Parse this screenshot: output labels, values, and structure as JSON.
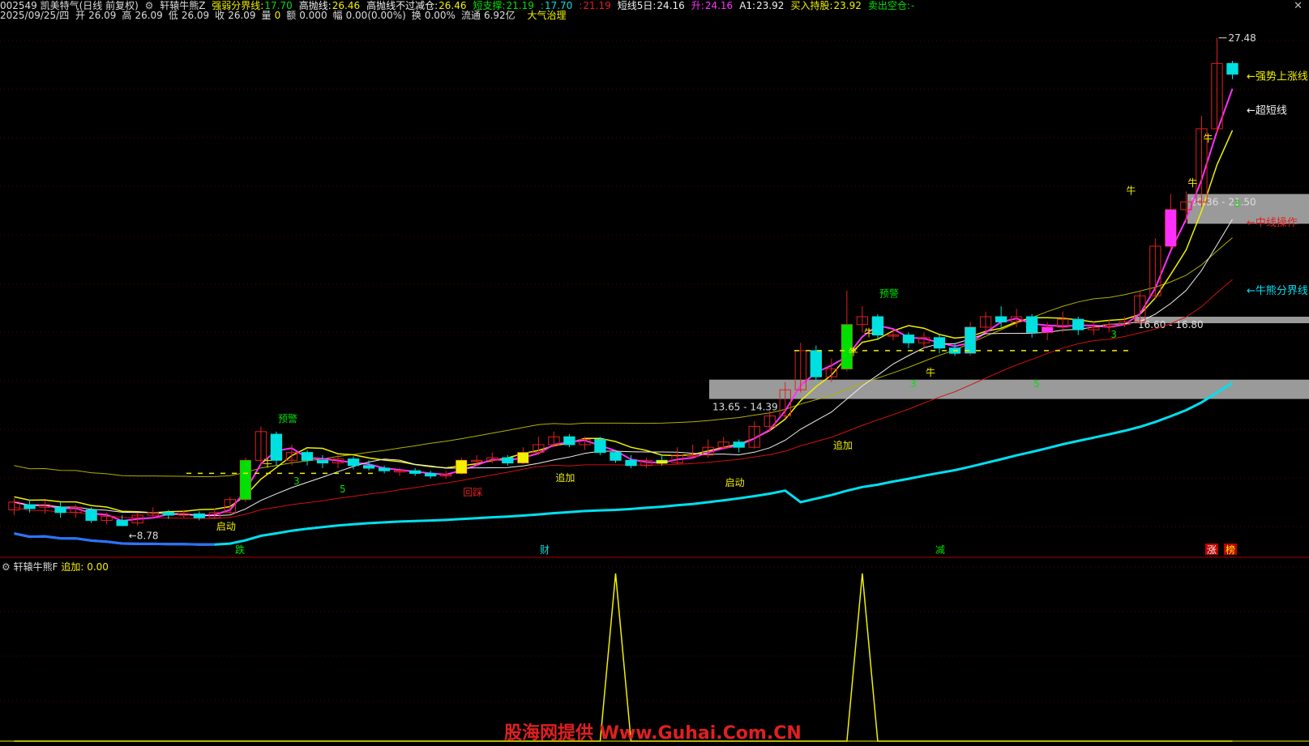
{
  "header1": {
    "stock": "002549 凯美特气(日线 前复权)",
    "indicator": "轩辕牛熊Z",
    "items": [
      {
        "label": "强弱分界线:",
        "value": "17.70",
        "lc": "#f0f000",
        "vc": "#00e000"
      },
      {
        "label": "高抛线:",
        "value": "26.46",
        "lc": "#f0f0f0",
        "vc": "#f0f000"
      },
      {
        "label": "高抛线不过减仓:",
        "value": "26.46",
        "lc": "#f0f0f0",
        "vc": "#f0f000"
      },
      {
        "label": "短支撑:",
        "value": "21.19",
        "lc": "#00e000",
        "vc": "#00e000"
      },
      {
        "label": ":",
        "value": "17.70",
        "lc": "#00e000",
        "vc": "#00e0e0"
      },
      {
        "label": ":",
        "value": "21.19",
        "lc": "#e02020",
        "vc": "#e02020"
      },
      {
        "label": "短线5日:",
        "value": "24.16",
        "lc": "#f0f0f0",
        "vc": "#f0f0f0"
      },
      {
        "label": "升:",
        "value": "24.16",
        "lc": "#ff30ff",
        "vc": "#ff30ff"
      },
      {
        "label": "A1:",
        "value": "23.92",
        "lc": "#f0f0f0",
        "vc": "#f0f0f0"
      },
      {
        "label": "买入持股:",
        "value": "23.92",
        "lc": "#f0f000",
        "vc": "#f0f000"
      },
      {
        "label": "卖出空仓:",
        "value": "-",
        "lc": "#00e000",
        "vc": "#00e000"
      }
    ]
  },
  "header2": {
    "date": "2025/09/25/四",
    "items": [
      {
        "label": "开",
        "value": "26.09"
      },
      {
        "label": "高",
        "value": "26.09"
      },
      {
        "label": "低",
        "value": "26.09"
      },
      {
        "label": "收",
        "value": "26.09"
      },
      {
        "label": "量",
        "value": "0"
      },
      {
        "label": "额",
        "value": "0.000"
      },
      {
        "label": "幅",
        "value": "0.00(0.00%)"
      },
      {
        "label": "换",
        "value": "0.00%"
      },
      {
        "label": "流通",
        "value": "6.92亿"
      }
    ],
    "extra": "大气治理"
  },
  "subchart": {
    "title": "轩辕牛熊F",
    "label": "追加:",
    "value": "0.00"
  },
  "watermark": "股海网提供 Www.Guhai.Com.CN",
  "close_icon": "close-icon",
  "colors": {
    "up": "#e02020",
    "down": "#00e0e0",
    "fast": "#ff30ff",
    "support": "#00e0f0"
  },
  "chart_data": [
    {
      "type": "candlestick",
      "title": "",
      "max_label": "27.48",
      "min_label": "8.78",
      "right_labels": [
        {
          "text": "强势上涨线",
          "color": "#f0f000"
        },
        {
          "text": "超短线",
          "color": "#f0f0f0"
        },
        {
          "text": "中线操作",
          "color": "#e02020"
        },
        {
          "text": "牛熊分界线",
          "color": "#00e0f0"
        }
      ],
      "zones": [
        {
          "label": "13.65 - 14.39",
          "low": 13.65,
          "high": 14.39
        },
        {
          "label": "16.60 - 16.80",
          "low": 16.6,
          "high": 16.8
        },
        {
          "label": "20.36 - 21.50",
          "low": 20.36,
          "high": 21.5
        }
      ],
      "signals": [
        {
          "text": "启动",
          "color": "#f0f000"
        },
        {
          "text": "预警",
          "color": "#00e000"
        },
        {
          "text": "回踩",
          "color": "#e02020"
        },
        {
          "text": "追加",
          "color": "#f0f000"
        },
        {
          "text": "启动",
          "color": "#f0f000"
        },
        {
          "text": "追加",
          "color": "#f0f000"
        },
        {
          "text": "预警",
          "color": "#00e000"
        },
        {
          "text": "牛",
          "color": "#f0f000"
        },
        {
          "text": "牛",
          "color": "#f0f000"
        },
        {
          "text": "牛",
          "color": "#f0f000"
        },
        {
          "text": "牛",
          "color": "#f0f000"
        },
        {
          "text": "牛",
          "color": "#f0f000"
        },
        {
          "text": "牛",
          "color": "#f0f000"
        },
        {
          "text": "牛",
          "color": "#f0f000"
        },
        {
          "text": "3",
          "color": "#00e000"
        },
        {
          "text": "5",
          "color": "#00e000"
        },
        {
          "text": "3",
          "color": "#00e000"
        },
        {
          "text": "3",
          "color": "#00e000"
        },
        {
          "text": "5",
          "color": "#00e000"
        },
        {
          "text": "3",
          "color": "#00e000"
        }
      ],
      "markers": [
        {
          "text": "跌",
          "color": "#00e000"
        },
        {
          "text": "财",
          "color": "#00e0e0"
        },
        {
          "text": "减",
          "color": "#00e000"
        },
        {
          "text": "涨",
          "color": "#f0f0f0"
        },
        {
          "text": "榜",
          "color": "#f0f000"
        }
      ],
      "support_line": [
        9.9,
        9.9,
        9.9,
        9.9,
        9.9,
        9.9,
        9.9,
        9.9,
        9.9,
        9.9,
        9.9,
        9.9,
        9.9,
        9.9,
        9.9,
        9.9,
        9.9,
        9.9,
        9.9,
        9.9,
        9.9,
        9.9,
        9.9,
        9.9,
        9.9,
        9.9,
        9.9,
        9.9,
        9.9,
        9.9,
        9.9,
        9.9,
        9.9,
        9.9,
        9.9,
        9.9,
        9.9,
        9.9,
        9.9,
        9.9,
        9.9,
        9.9,
        9.9,
        9.9,
        9.9,
        9.9,
        9.9,
        9.9,
        9.9,
        9.9,
        9.9,
        9.9,
        9.9,
        9.9,
        9.9,
        9.9,
        9.9,
        9.9,
        9.9,
        9.9,
        9.9,
        9.9,
        9.9,
        9.9,
        9.9,
        9.9,
        9.9,
        9.9,
        9.9,
        9.9,
        9.9,
        9.9,
        9.9,
        9.9,
        9.9,
        9.9,
        9.9,
        9.9,
        9.9,
        9.9
      ],
      "candles": [
        [
          9.4,
          9.7,
          9.85,
          9.2
        ],
        [
          9.6,
          9.45,
          9.8,
          9.3
        ],
        [
          9.5,
          9.6,
          9.75,
          9.25
        ],
        [
          9.5,
          9.3,
          9.7,
          9.1
        ],
        [
          9.3,
          9.5,
          9.6,
          9.1
        ],
        [
          9.4,
          9.0,
          9.5,
          8.9
        ],
        [
          9.0,
          9.15,
          9.3,
          8.85
        ],
        [
          9.0,
          8.8,
          9.2,
          8.78
        ],
        [
          8.9,
          9.2,
          9.3,
          8.8
        ],
        [
          9.2,
          9.3,
          9.5,
          9.1
        ],
        [
          9.3,
          9.2,
          9.4,
          9.05
        ],
        [
          9.2,
          9.25,
          9.4,
          9.1
        ],
        [
          9.25,
          9.1,
          9.35,
          9.0
        ],
        [
          9.1,
          9.3,
          9.45,
          9.05
        ],
        [
          9.3,
          9.8,
          9.9,
          9.25
        ],
        [
          9.8,
          11.3,
          11.4,
          9.7
        ],
        [
          11.3,
          12.4,
          12.6,
          11.1
        ],
        [
          12.3,
          11.3,
          12.4,
          11.1
        ],
        [
          11.3,
          11.6,
          11.9,
          11.1
        ],
        [
          11.6,
          11.3,
          11.7,
          11.1
        ],
        [
          11.3,
          11.2,
          11.5,
          11.0
        ],
        [
          11.2,
          11.35,
          11.5,
          11.0
        ],
        [
          11.35,
          11.1,
          11.45,
          10.95
        ],
        [
          11.1,
          11.0,
          11.3,
          10.9
        ],
        [
          11.0,
          10.9,
          11.1,
          10.8
        ],
        [
          10.9,
          10.9,
          11.0,
          10.7
        ],
        [
          10.9,
          10.8,
          11.0,
          10.7
        ],
        [
          10.8,
          10.7,
          10.9,
          10.6
        ],
        [
          10.7,
          10.75,
          10.9,
          10.6
        ],
        [
          10.8,
          11.3,
          11.4,
          10.75
        ],
        [
          11.3,
          11.3,
          11.5,
          11.1
        ],
        [
          11.3,
          11.4,
          11.6,
          11.2
        ],
        [
          11.4,
          11.2,
          11.5,
          11.1
        ],
        [
          11.2,
          11.6,
          11.8,
          11.15
        ],
        [
          11.6,
          11.9,
          12.2,
          11.5
        ],
        [
          11.9,
          12.2,
          12.4,
          11.8
        ],
        [
          12.2,
          11.9,
          12.3,
          11.8
        ],
        [
          11.9,
          12.1,
          12.2,
          11.7
        ],
        [
          12.1,
          11.6,
          12.2,
          11.5
        ],
        [
          11.6,
          11.3,
          11.7,
          11.2
        ],
        [
          11.3,
          11.1,
          11.5,
          11.0
        ],
        [
          11.1,
          11.3,
          11.4,
          11.0
        ],
        [
          11.3,
          11.2,
          11.5,
          11.1
        ],
        [
          11.2,
          11.5,
          11.8,
          11.15
        ],
        [
          11.5,
          11.5,
          11.9,
          11.4
        ],
        [
          11.5,
          11.8,
          12.1,
          11.4
        ],
        [
          11.8,
          12.0,
          12.2,
          11.7
        ],
        [
          12.0,
          11.8,
          12.1,
          11.6
        ],
        [
          11.8,
          12.6,
          12.8,
          11.75
        ],
        [
          12.6,
          13.0,
          13.2,
          12.4
        ],
        [
          13.0,
          14.0,
          14.3,
          12.9
        ],
        [
          14.0,
          15.5,
          15.8,
          13.9
        ],
        [
          15.5,
          14.5,
          15.7,
          14.3
        ],
        [
          14.5,
          14.8,
          15.2,
          14.3
        ],
        [
          14.8,
          16.5,
          17.8,
          14.7
        ],
        [
          16.5,
          16.8,
          17.2,
          16.2
        ],
        [
          16.8,
          16.1,
          16.9,
          15.9
        ],
        [
          16.1,
          16.1,
          16.3,
          15.9
        ],
        [
          16.1,
          15.8,
          16.2,
          15.6
        ],
        [
          15.8,
          16.0,
          16.2,
          15.6
        ],
        [
          16.0,
          15.6,
          16.1,
          15.4
        ],
        [
          15.6,
          15.4,
          15.8,
          15.3
        ],
        [
          15.4,
          16.4,
          16.6,
          15.3
        ],
        [
          16.4,
          16.8,
          17.0,
          16.2
        ],
        [
          16.8,
          16.6,
          17.2,
          16.4
        ],
        [
          16.6,
          16.8,
          17.1,
          16.4
        ],
        [
          16.8,
          16.2,
          16.9,
          16.0
        ],
        [
          16.2,
          16.4,
          16.6,
          15.9
        ],
        [
          16.4,
          16.7,
          17.0,
          16.2
        ],
        [
          16.7,
          16.3,
          16.8,
          16.1
        ],
        [
          16.3,
          16.4,
          16.6,
          16.1
        ],
        [
          16.4,
          16.5,
          16.7,
          16.2
        ],
        [
          16.5,
          16.6,
          16.8,
          16.4
        ],
        [
          16.6,
          17.6,
          17.8,
          16.5
        ],
        [
          17.6,
          19.5,
          19.8,
          17.5
        ],
        [
          19.5,
          20.9,
          21.5,
          19.4
        ],
        [
          20.9,
          21.2,
          21.6,
          20.4
        ],
        [
          21.2,
          24.0,
          24.5,
          21.0
        ],
        [
          24.0,
          26.5,
          27.48,
          23.8
        ],
        [
          26.5,
          26.09,
          26.6,
          25.9
        ]
      ],
      "sub_series": {
        "name": "追加",
        "values": [
          0,
          0,
          0,
          0,
          0,
          0,
          0,
          0,
          0,
          0,
          0,
          0,
          0,
          0,
          0,
          0,
          0,
          0,
          0,
          0,
          0,
          0,
          0,
          0,
          0,
          0,
          0,
          0,
          0,
          0,
          0,
          0,
          0,
          0,
          0,
          0,
          0,
          0,
          0,
          1,
          0,
          0,
          0,
          0,
          0,
          0,
          0,
          0,
          0,
          0,
          0,
          0,
          0,
          0,
          0,
          1,
          0,
          0,
          0,
          0,
          0,
          0,
          0,
          0,
          0,
          0,
          0,
          0,
          0,
          0,
          0,
          0,
          0,
          0,
          0,
          0,
          0,
          0,
          0,
          0
        ]
      }
    }
  ]
}
